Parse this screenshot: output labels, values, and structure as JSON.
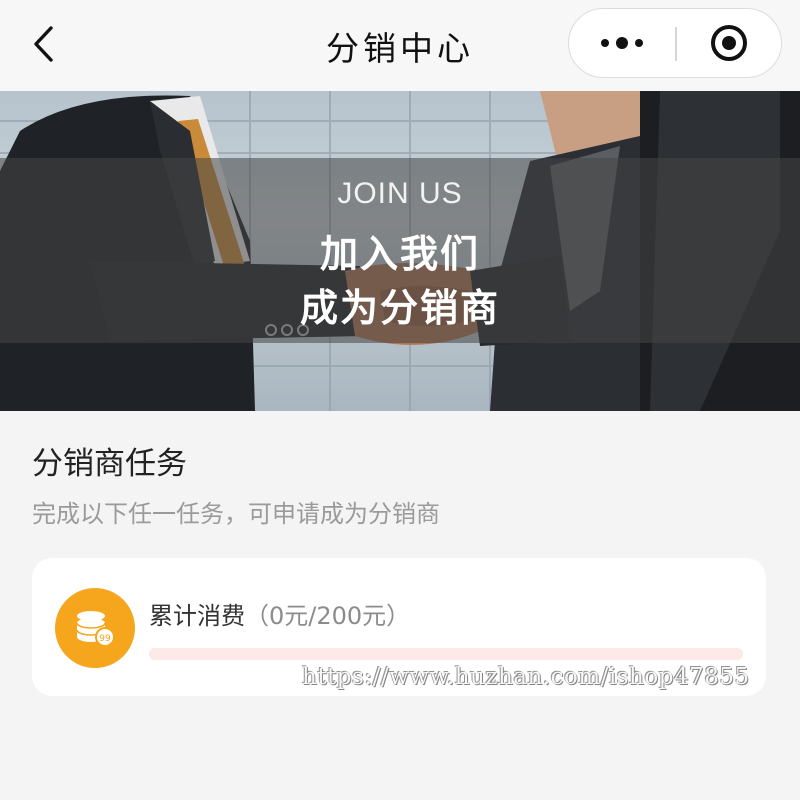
{
  "navbar": {
    "title": "分销中心",
    "back_icon": "chevron-left-icon",
    "more_icon": "more-dots-icon",
    "close_icon": "target-circle-icon"
  },
  "banner": {
    "join_us": "JOIN US",
    "line1": "加入我们",
    "line2": "成为分销商"
  },
  "section": {
    "title": "分销商任务",
    "subtitle": "完成以下任一任务，可申请成为分销商"
  },
  "task": {
    "icon": "coins-icon",
    "label": "累计消费",
    "progress_text": "（0元/200元）",
    "progress_current": 0,
    "progress_target": 200,
    "accent_color": "#f6a61c",
    "progress_color": "#f06a55",
    "track_color": "#fde9e7"
  },
  "watermark": {
    "text": "https://www.huzhan.com/ishop47855"
  }
}
